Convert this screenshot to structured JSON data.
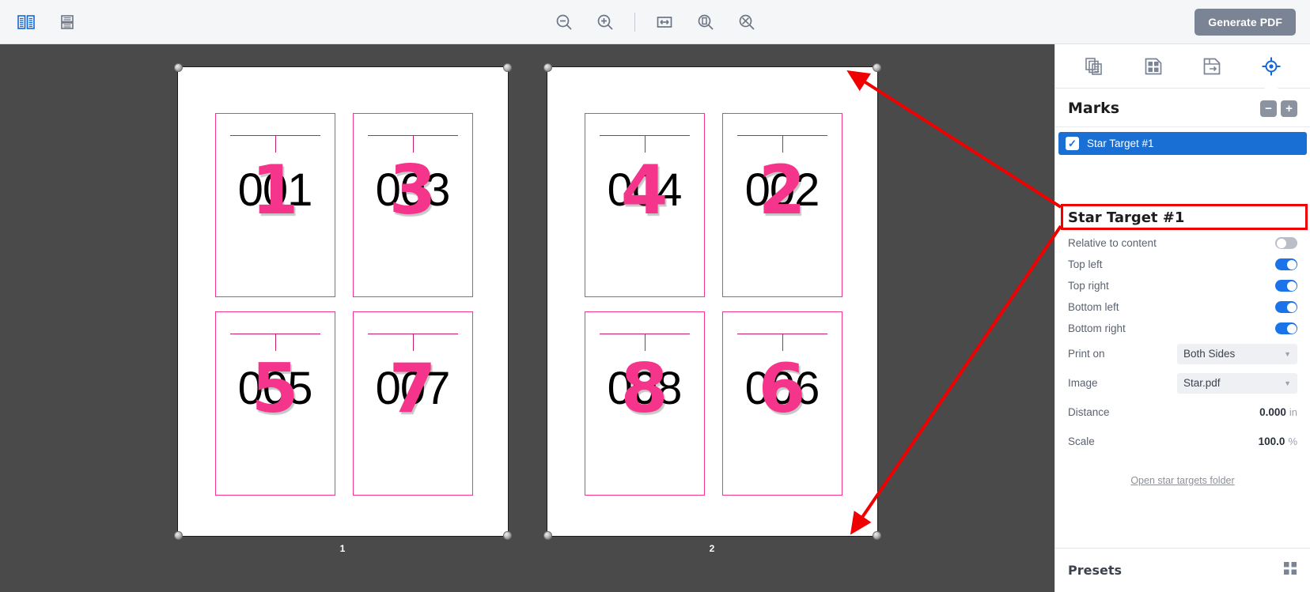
{
  "toolbar": {
    "left_icons": [
      {
        "name": "spread-view-icon",
        "state": "active"
      },
      {
        "name": "single-page-view-icon",
        "state": "inactive"
      }
    ],
    "center_icons": [
      {
        "name": "zoom-out-icon"
      },
      {
        "name": "zoom-in-icon"
      },
      {
        "name": "fit-width-icon"
      },
      {
        "name": "fit-page-icon"
      },
      {
        "name": "actual-size-icon"
      }
    ],
    "generate_pdf_label": "Generate PDF"
  },
  "panel": {
    "tabs": [
      {
        "name": "tab-pages",
        "icon": "copy-pages-icon",
        "selected": false
      },
      {
        "name": "tab-layout",
        "icon": "grid-layout-icon",
        "selected": false
      },
      {
        "name": "tab-imposition",
        "icon": "imposition-flow-icon",
        "selected": false
      },
      {
        "name": "tab-marks",
        "icon": "registration-target-icon",
        "selected": true
      }
    ],
    "marks_header": {
      "title": "Marks",
      "remove_label": "−",
      "add_label": "+"
    },
    "marks_list": [
      {
        "label": "Star Target #1",
        "checked": true
      }
    ],
    "properties": {
      "title": "Star Target #1",
      "rows": [
        {
          "label": "Relative to content",
          "type": "toggle",
          "value": false,
          "highlighted": true
        },
        {
          "label": "Top left",
          "type": "toggle",
          "value": true
        },
        {
          "label": "Top right",
          "type": "toggle",
          "value": true
        },
        {
          "label": "Bottom left",
          "type": "toggle",
          "value": true
        },
        {
          "label": "Bottom right",
          "type": "toggle",
          "value": true
        },
        {
          "label": "Print on",
          "type": "select",
          "value": "Both Sides"
        },
        {
          "label": "Image",
          "type": "select",
          "value": "Star.pdf"
        },
        {
          "label": "Distance",
          "type": "value",
          "value": "0.000",
          "unit": "in"
        },
        {
          "label": "Scale",
          "type": "value",
          "value": "100.0",
          "unit": "%"
        }
      ],
      "folder_link": "Open star targets folder"
    },
    "presets": {
      "title": "Presets",
      "icon": "presets-grid-icon"
    }
  },
  "canvas": {
    "pages": [
      {
        "label": "1",
        "cards": [
          {
            "number": "001",
            "overlay": "1"
          },
          {
            "number": "003",
            "overlay": "3"
          },
          {
            "number": "005",
            "overlay": "5"
          },
          {
            "number": "007",
            "overlay": "7"
          }
        ]
      },
      {
        "label": "2",
        "cards": [
          {
            "number": "004",
            "overlay": "4"
          },
          {
            "number": "002",
            "overlay": "2"
          },
          {
            "number": "008",
            "overlay": "8"
          },
          {
            "number": "006",
            "overlay": "6"
          }
        ]
      }
    ],
    "corner_marks": [
      "top-left",
      "top-right",
      "bottom-left",
      "bottom-right"
    ]
  },
  "colors": {
    "accent_blue": "#1a6fd4",
    "toolbar_bg": "#f4f6f8",
    "canvas_bg": "#4a4a4a",
    "mark_pink": "#f5348c",
    "annotation_red": "#f00000",
    "generate_btn": "#7b8494"
  }
}
